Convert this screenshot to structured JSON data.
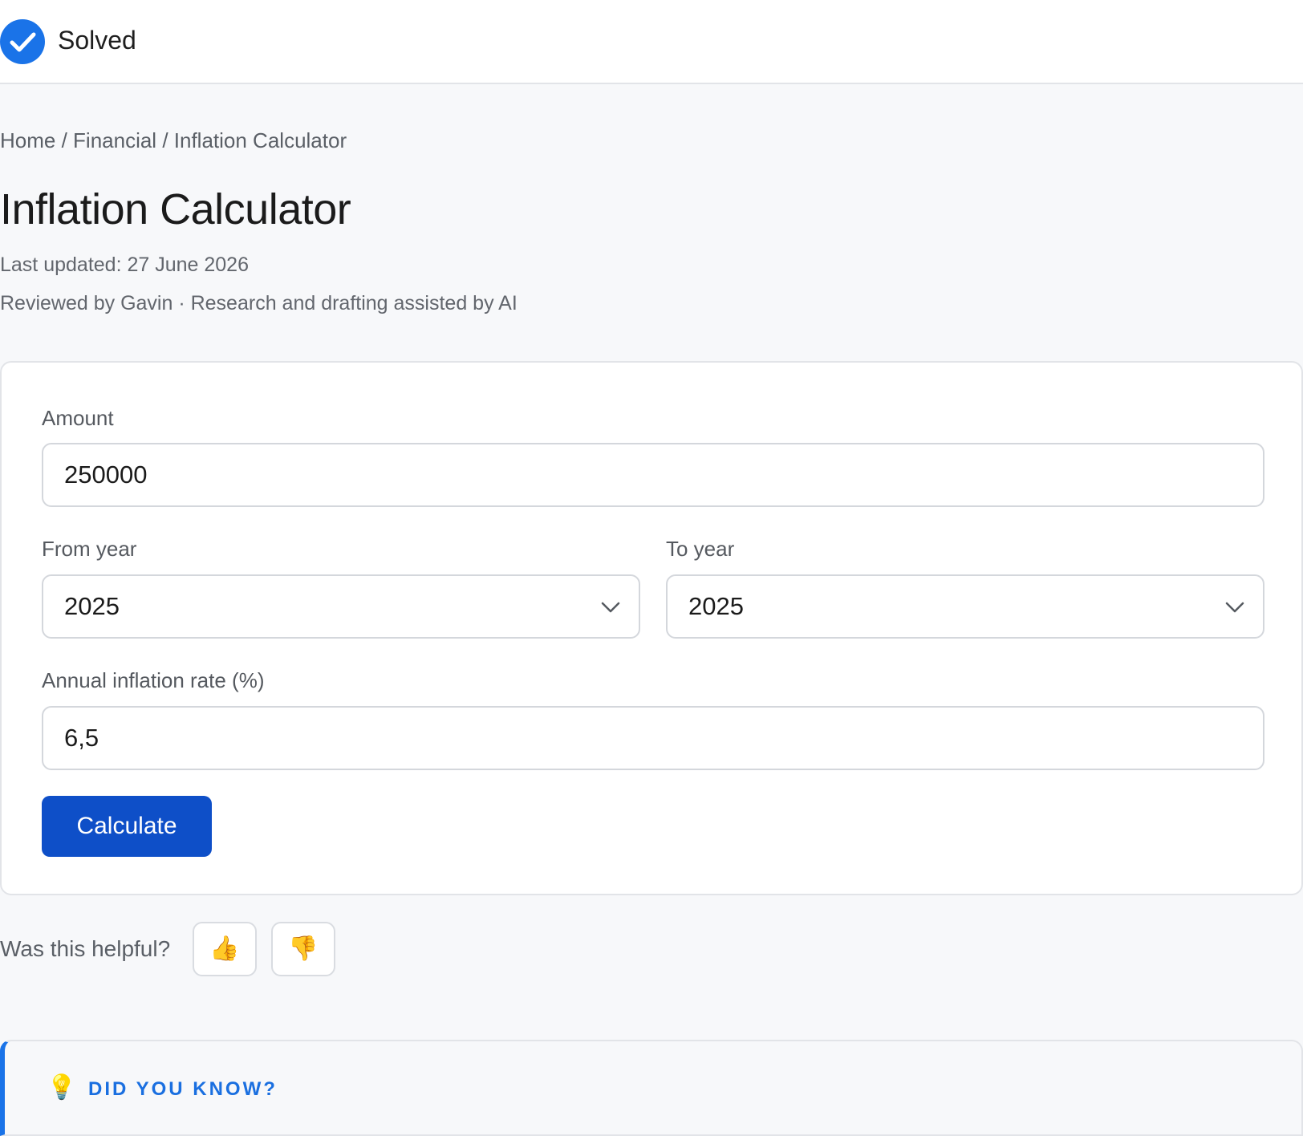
{
  "header": {
    "status_label": "Solved",
    "status_icon": "check-circle-icon",
    "accent_color": "#1a73e8"
  },
  "breadcrumb": {
    "items": [
      "Home",
      "Financial",
      "Inflation Calculator"
    ],
    "separator": " / "
  },
  "page": {
    "title": "Inflation Calculator",
    "last_updated": "Last updated: 27 June 2026",
    "reviewed": "Reviewed by Gavin · Research and drafting assisted by AI"
  },
  "form": {
    "amount_label": "Amount",
    "amount_value": "250000",
    "from_year_label": "From year",
    "from_year_value": "2025",
    "to_year_label": "To year",
    "to_year_value": "2025",
    "rate_label": "Annual inflation rate (%)",
    "rate_value": "6,5",
    "calculate_label": "Calculate",
    "button_color": "#0e4fc8"
  },
  "feedback": {
    "question": "Was this helpful?",
    "thumbs_up": "👍",
    "thumbs_down": "👎"
  },
  "tip": {
    "icon": "💡",
    "heading": "DID YOU KNOW?"
  }
}
